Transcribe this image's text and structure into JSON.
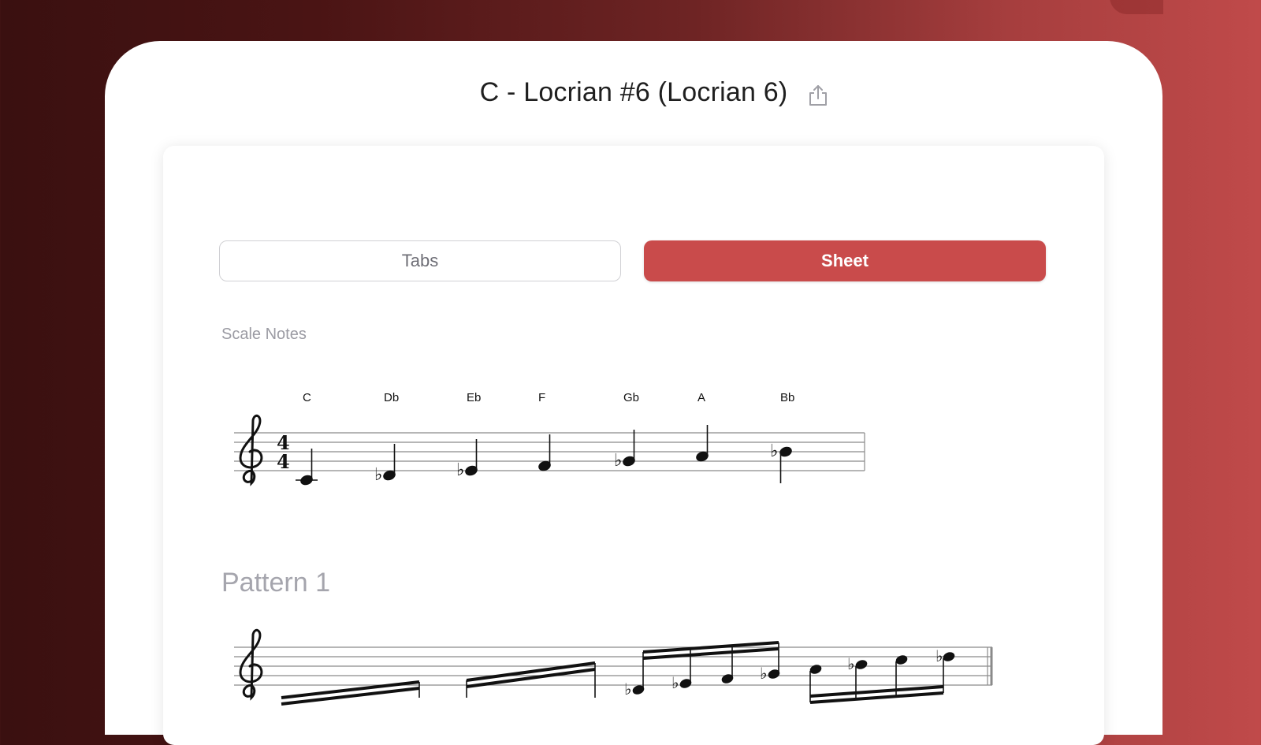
{
  "header": {
    "title": "C - Locrian #6 (Locrian 6)",
    "share_icon": "share-icon"
  },
  "segmented": {
    "tabs_label": "Tabs",
    "sheet_label": "Sheet",
    "selected": "Sheet"
  },
  "scale_section": {
    "label": "Scale Notes",
    "time_signature": "4/4",
    "clef": "treble",
    "notes": [
      "C",
      "Db",
      "Eb",
      "F",
      "Gb",
      "A",
      "Bb"
    ]
  },
  "pattern_section": {
    "title": "Pattern 1",
    "clef": "treble"
  },
  "colors": {
    "accent": "#c94b4b",
    "background_dark": "#3a1010",
    "background_light": "#c04a4a"
  }
}
